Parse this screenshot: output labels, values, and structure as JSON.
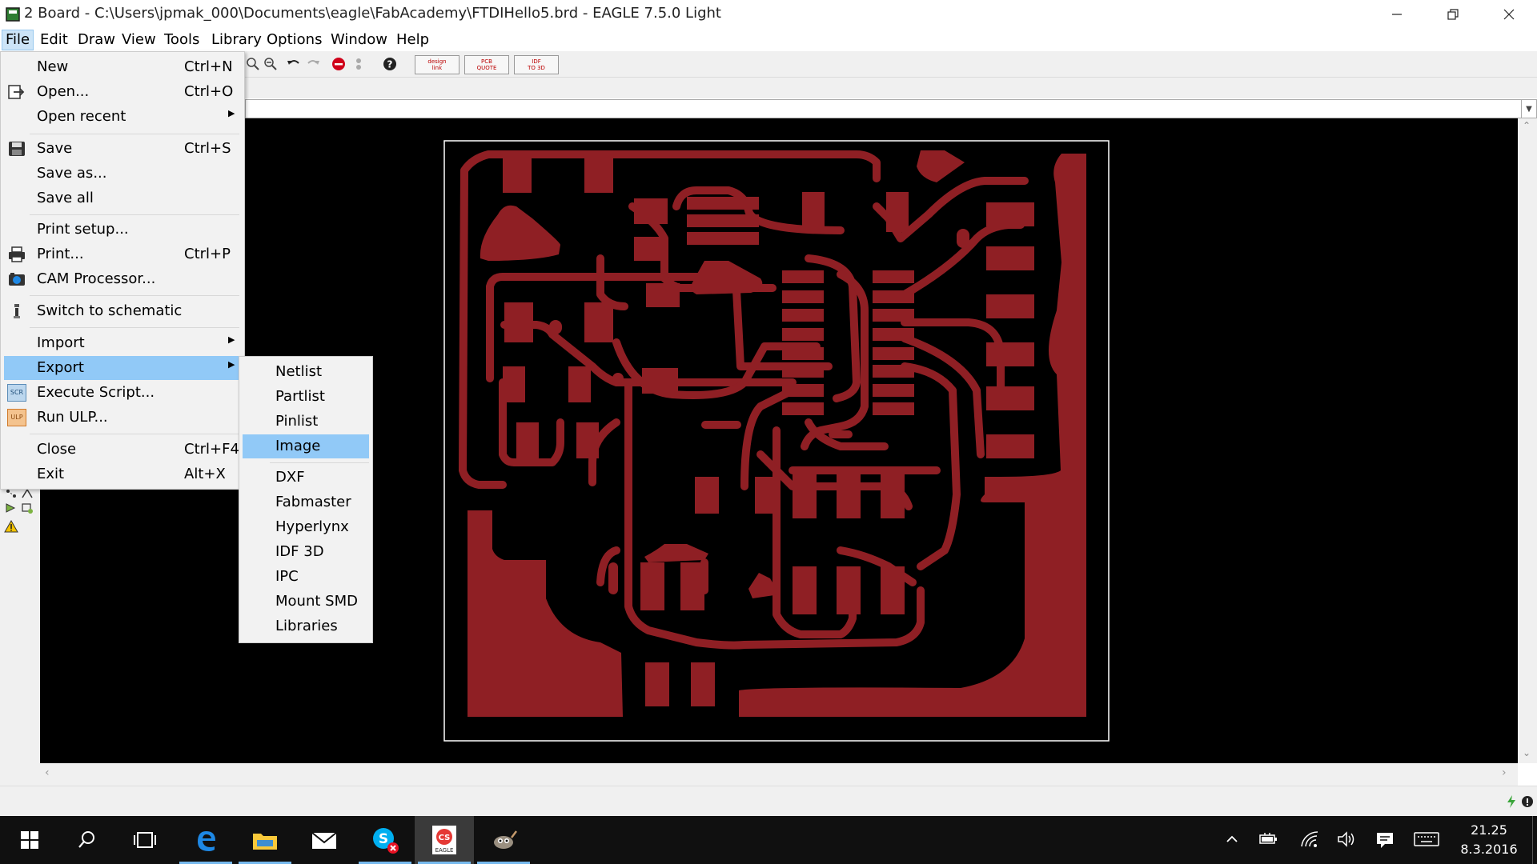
{
  "window": {
    "title": "2 Board - C:\\Users\\jpmak_000\\Documents\\eagle\\FabAcademy\\FTDIHello5.brd - EAGLE 7.5.0 Light",
    "controls": [
      "minimize-icon",
      "restore-icon",
      "close-icon"
    ]
  },
  "menubar": {
    "items": [
      "File",
      "Edit",
      "Draw",
      "View",
      "Tools",
      "Library",
      "Options",
      "Window",
      "Help"
    ],
    "active": "File"
  },
  "toolbar": {
    "badges": [
      {
        "top": "design",
        "bottom": "link"
      },
      {
        "top": "PCB",
        "bottom": "QUOTE"
      },
      {
        "top": "IDF",
        "bottom": "TO 3D"
      }
    ]
  },
  "file_menu": {
    "items": [
      {
        "label": "New",
        "shortcut": "Ctrl+N",
        "icon": ""
      },
      {
        "label": "Open...",
        "shortcut": "Ctrl+O",
        "icon": "open-icon"
      },
      {
        "label": "Open recent",
        "shortcut": "",
        "submenu": true
      },
      {
        "label": "Save",
        "shortcut": "Ctrl+S",
        "icon": "save-icon"
      },
      {
        "label": "Save as...",
        "shortcut": ""
      },
      {
        "label": "Save all",
        "shortcut": ""
      },
      {
        "label": "Print setup...",
        "shortcut": ""
      },
      {
        "label": "Print...",
        "shortcut": "Ctrl+P",
        "icon": "printer-icon"
      },
      {
        "label": "CAM Processor...",
        "shortcut": "",
        "icon": "cam-icon"
      },
      {
        "label": "Switch to schematic",
        "shortcut": "",
        "icon": "switch-icon"
      },
      {
        "label": "Import",
        "shortcut": "",
        "submenu": true
      },
      {
        "label": "Export",
        "shortcut": "",
        "submenu": true,
        "highlighted": true
      },
      {
        "label": "Execute Script...",
        "shortcut": "",
        "icon": "script-icon",
        "icon_text": "SCR"
      },
      {
        "label": "Run ULP...",
        "shortcut": "",
        "icon": "ulp-icon",
        "icon_text": "ULP"
      },
      {
        "label": "Close",
        "shortcut": "Ctrl+F4"
      },
      {
        "label": "Exit",
        "shortcut": "Alt+X"
      }
    ]
  },
  "export_submenu": {
    "items": [
      "Netlist",
      "Partlist",
      "Pinlist",
      "Image",
      "DXF",
      "Fabmaster",
      "Hyperlynx",
      "IDF 3D",
      "IPC",
      "Mount SMD",
      "Libraries"
    ],
    "highlighted": "Image"
  },
  "pcb": {
    "trace_color": "#8f1f24",
    "background": "#000000",
    "outline_color": "#ffffff"
  },
  "taskbar": {
    "apps": [
      "start-icon",
      "search-icon",
      "task-view-icon",
      "edge-icon",
      "file-explorer-icon",
      "mail-icon",
      "skype-icon",
      "eagle-icon",
      "gimp-icon"
    ],
    "time": "21.25",
    "date": "8.3.2016"
  }
}
